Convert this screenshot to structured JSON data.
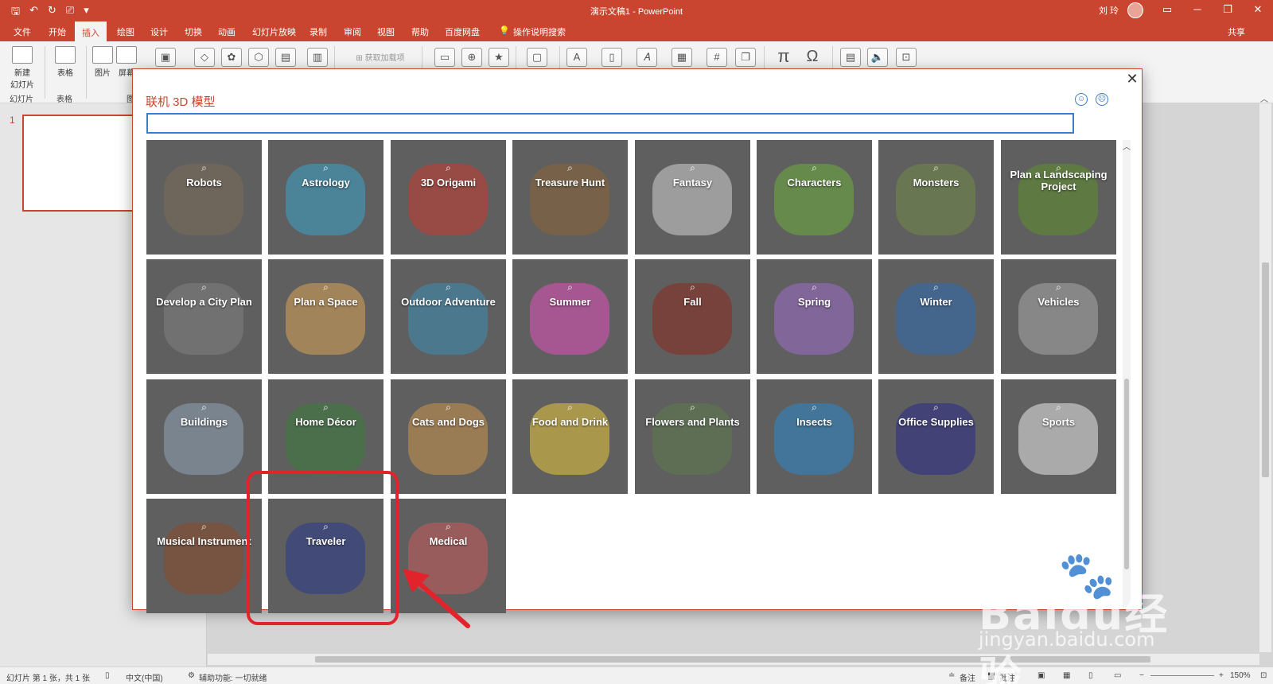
{
  "app": {
    "title": "演示文稿1  -  PowerPoint",
    "user": "刘 玲",
    "accent_color": "#c9452f"
  },
  "quick_access": [
    "save-icon",
    "undo-icon",
    "redo-icon",
    "present-icon",
    "customize-icon"
  ],
  "tabs": [
    {
      "label": "文件"
    },
    {
      "label": "开始"
    },
    {
      "label": "插入"
    },
    {
      "label": "绘图"
    },
    {
      "label": "设计"
    },
    {
      "label": "切换"
    },
    {
      "label": "动画"
    },
    {
      "label": "幻灯片放映"
    },
    {
      "label": "录制"
    },
    {
      "label": "审阅"
    },
    {
      "label": "视图"
    },
    {
      "label": "帮助"
    },
    {
      "label": "百度网盘"
    },
    {
      "label": "操作说明搜索"
    }
  ],
  "active_tab": "插入",
  "share_label": "共享",
  "ribbon": {
    "new_slide": "新建\n幻灯片",
    "table": "表格",
    "picture": "图片",
    "screenshot": "屏幕",
    "addins": "获取加载项",
    "groups": {
      "slides": "幻灯片",
      "tables": "表格",
      "images": "图"
    }
  },
  "slide_panel": {
    "number": "1"
  },
  "dialog": {
    "title": "联机 3D 模型",
    "close_label": "✕",
    "search_placeholder": "",
    "categories": [
      {
        "label": "Robots",
        "color": "#7a6a58"
      },
      {
        "label": "Astrology",
        "color": "#3aa0c8"
      },
      {
        "label": "3D Origami",
        "color": "#c63a2e"
      },
      {
        "label": "Treasure Hunt",
        "color": "#8a6236"
      },
      {
        "label": "Fantasy",
        "color": "#cfcfcf"
      },
      {
        "label": "Characters",
        "color": "#6cad3c"
      },
      {
        "label": "Monsters",
        "color": "#6f8a46"
      },
      {
        "label": "Plan a Landscaping Project",
        "color": "#5c8f2a"
      },
      {
        "label": "Develop a City Plan",
        "color": "#7f7f7f"
      },
      {
        "label": "Plan a Space",
        "color": "#d8a255"
      },
      {
        "label": "Outdoor Adventure",
        "color": "#3c8cb4"
      },
      {
        "label": "Summer",
        "color": "#e04fb8"
      },
      {
        "label": "Fall",
        "color": "#8a2a1e"
      },
      {
        "label": "Spring",
        "color": "#9a6cc8"
      },
      {
        "label": "Winter",
        "color": "#2e6cb0"
      },
      {
        "label": "Vehicles",
        "color": "#a8a8a8"
      },
      {
        "label": "Buildings",
        "color": "#8fa2b4"
      },
      {
        "label": "Home Décor",
        "color": "#3b7a3b"
      },
      {
        "label": "Cats and Dogs",
        "color": "#c8924a"
      },
      {
        "label": "Food and Drink",
        "color": "#e6c63c"
      },
      {
        "label": "Flowers and Plants",
        "color": "#5c7a4c"
      },
      {
        "label": "Insects",
        "color": "#2a86c8"
      },
      {
        "label": "Office Supplies",
        "color": "#2a2a8a"
      },
      {
        "label": "Sports",
        "color": "#e8e8e8"
      },
      {
        "label": "Musical Instrument",
        "color": "#8a4a2a"
      },
      {
        "label": "Traveler",
        "color": "#2a3a8a"
      },
      {
        "label": "Medical",
        "color": "#c85a5a"
      }
    ]
  },
  "statusbar": {
    "slide_info": "幻灯片 第 1 张，共 1 张",
    "language": "中文(中国)",
    "accessibility": "辅助功能: 一切就绪",
    "notes": "备注",
    "comments": "批注",
    "zoom": "150%"
  },
  "watermark": {
    "brand": "Baidu经验",
    "url": "jingyan.baidu.com"
  }
}
